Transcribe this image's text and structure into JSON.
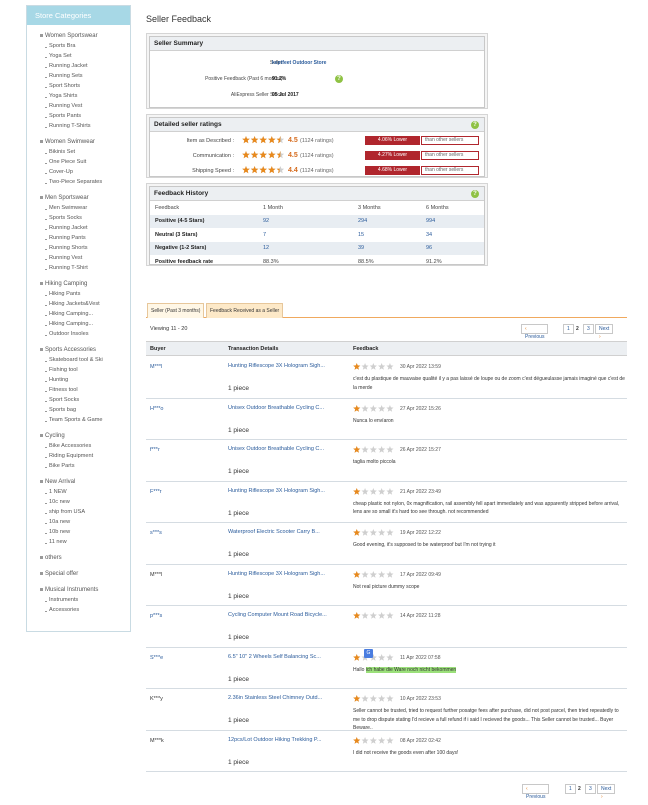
{
  "sidebar": {
    "title": "Store Categories",
    "groups": [
      {
        "label": "Women Sportswear",
        "items": [
          "Sports Bra",
          "Yoga Set",
          "Running Jacket",
          "Running Sets",
          "Sport Shorts",
          "Yoga Shirts",
          "Running Vest",
          "Sports Pants",
          "Running T-Shirts"
        ]
      },
      {
        "label": "Women Swimwear",
        "items": [
          "Bikinis Set",
          "One Piece Suit",
          "Cover-Up",
          "Two-Piece Separates"
        ]
      },
      {
        "label": "Men Sportswear",
        "items": [
          "Men Swimwear",
          "Sports Socks",
          "Running Jacket",
          "Running Pants",
          "Running Shorts",
          "Running Vest",
          "Running T-Shirt"
        ]
      },
      {
        "label": "Hiking Camping",
        "items": [
          "Hiking Pants",
          "Hiking Jackets&Vest",
          "Hiking Camping...",
          "Hiking Camping...",
          "Outdoor Insoles"
        ]
      },
      {
        "label": "Sports Accessories",
        "items": [
          "Skateboard tool & Ski",
          "Fishing tool",
          "Hunting",
          "Fitness tool",
          "Sport Socks",
          "Sports bag",
          "Team Sports & Game"
        ]
      },
      {
        "label": "Cycling",
        "items": [
          "Bike Accessories",
          "Riding Equipment",
          "Bike Parts"
        ]
      },
      {
        "label": "New Arrival",
        "items": [
          "1 NEW",
          "10c new",
          "ship from USA",
          "10a new",
          "10b new",
          "11 new"
        ]
      },
      {
        "label": "others",
        "items": []
      },
      {
        "label": "Special offer",
        "items": []
      },
      {
        "label": "Musical Instruments",
        "items": [
          "Instruments",
          "Accessories"
        ]
      }
    ]
  },
  "page_title": "Seller Feedback",
  "summary": {
    "title": "Seller Summary",
    "seller_label": "Seller:",
    "seller_value": "keptfeet Outdoor Store",
    "positive_label": "Positive Feedback (Past 6 months):",
    "positive_value": "91.2%",
    "since_label": "AliExpress Seller Since:",
    "since_value": "05 Jul 2017"
  },
  "detailed": {
    "title": "Detailed seller ratings",
    "rows": [
      {
        "label": "Item as Described :",
        "score": "4.5",
        "stars": 4.5,
        "count": "(1124 ratings)",
        "diff": "4.06% Lower",
        "other": "than other sellers"
      },
      {
        "label": "Communication :",
        "score": "4.5",
        "stars": 4.5,
        "count": "(1124 ratings)",
        "diff": "4.27% Lower",
        "other": "than other sellers"
      },
      {
        "label": "Shipping Speed :",
        "score": "4.4",
        "stars": 4.4,
        "count": "(1124 ratings)",
        "diff": "4.68% Lower",
        "other": "than other sellers"
      }
    ]
  },
  "history": {
    "title": "Feedback History",
    "headers": [
      "Feedback",
      "1 Month",
      "3 Months",
      "6 Months"
    ],
    "rows": [
      [
        "Positive (4-5 Stars)",
        "92",
        "294",
        "994"
      ],
      [
        "Neutral (3 Stars)",
        "7",
        "15",
        "34"
      ],
      [
        "Negative (1-2 Stars)",
        "12",
        "39",
        "96"
      ],
      [
        "Positive feedback rate",
        "88.3%",
        "88.5%",
        "91.2%"
      ]
    ]
  },
  "tabs": [
    "Seller (Past 3 months)",
    "Feedback Received as a Seller"
  ],
  "viewing": "Viewing 11 - 20",
  "pager": {
    "prev": "Previous",
    "p1": "1",
    "p2": "2",
    "p3": "3",
    "next": "Next"
  },
  "fb_headers": {
    "buyer": "Buyer",
    "transaction": "Transaction Details",
    "feedback": "Feedback"
  },
  "feedback": [
    {
      "buyer": "M***l",
      "product": "Hunting Riflescope 3X Hologram Sigh...",
      "qty": "1 piece",
      "stars": 1,
      "date": "30 Apr 2022 13:59",
      "text": "c'est du plastique de mauvaise qualité il y a pas laissé de loupe ou de zoom c'est dégueulasse jamais imaginé que c'est de la merde"
    },
    {
      "buyer": "H***o",
      "product": "Unisex Outdoor Breathable Cycling C...",
      "qty": "1 piece",
      "stars": 1,
      "date": "27 Apr 2022 15:26",
      "text": "Nunca lo envíaron"
    },
    {
      "buyer": "f***r",
      "product": "Unisex Outdoor Breathable Cycling C...",
      "qty": "1 piece",
      "stars": 1,
      "date": "26 Apr 2022 15:27",
      "text": "taglia molto piccola"
    },
    {
      "buyer": "F***r",
      "product": "Hunting Riflescope 3X Hologram Sigh...",
      "qty": "1 piece",
      "stars": 1,
      "date": "21 Apr 2022 23:49",
      "text": "cheap plastic not nylon, 0x magnification, rail assembly fell apart immediately and was apparently stripped before arrival, lens are so small it's hard too see through. not recommended"
    },
    {
      "buyer": "s***s",
      "product": "Waterproof Electric Scooter Carry B...",
      "qty": "1 piece",
      "stars": 1,
      "date": "19 Apr 2022 12:22",
      "text": "Good evening, it's supposed to be waterproof but I'm not trying it"
    },
    {
      "buyer": "M***l",
      "product": "Hunting Riflescope 3X Hologram Sigh...",
      "qty": "1 piece",
      "stars": 1,
      "date": "17 Apr 2022 09:49",
      "text": "Not real picture dummy scope"
    },
    {
      "buyer": "p***s",
      "product": "Cycling Computer Mount Road Bicycle...",
      "qty": "1 piece",
      "stars": 1,
      "date": "14 Apr 2022 11:28",
      "text": ""
    },
    {
      "buyer": "S***e",
      "product": "6.5\" 10\" 2 Wheels Self Balancing Sc...",
      "qty": "1 piece",
      "stars": 1,
      "date": "11 Apr 2022 07:58",
      "text_pre": "Hallo ",
      "text_hl": "ich habe die Ware noch nicht bekommen"
    },
    {
      "buyer": "K***y",
      "product": "2.36in Stainless Steel Chimney Outd...",
      "qty": "1 piece",
      "stars": 1,
      "date": "10 Apr 2022 23:53",
      "text": "Seller cannot be trusted, tried to request further posatge fees after purchase, did not post parcel, then tried repeatedly to me to drop dispute stating I'd recieve a full refund if i said I recieved the goods... This Seller cannot be trusted... Buyer Beware.."
    },
    {
      "buyer": "M***k",
      "product": "12pcs/Lot Outdoor Hiking Trekking P...",
      "qty": "1 piece",
      "stars": 1,
      "date": "08 Apr 2022 02:42",
      "text": "I did not receive the goods even after 100 days!"
    }
  ],
  "colors": {
    "sidebar_head": "#a7d8e6",
    "star": "#e8891c",
    "star_empty": "#cfcfcf",
    "lower_badge": "#b0262d",
    "link": "#2a5b9b",
    "tab_border": "#f0a95e"
  }
}
